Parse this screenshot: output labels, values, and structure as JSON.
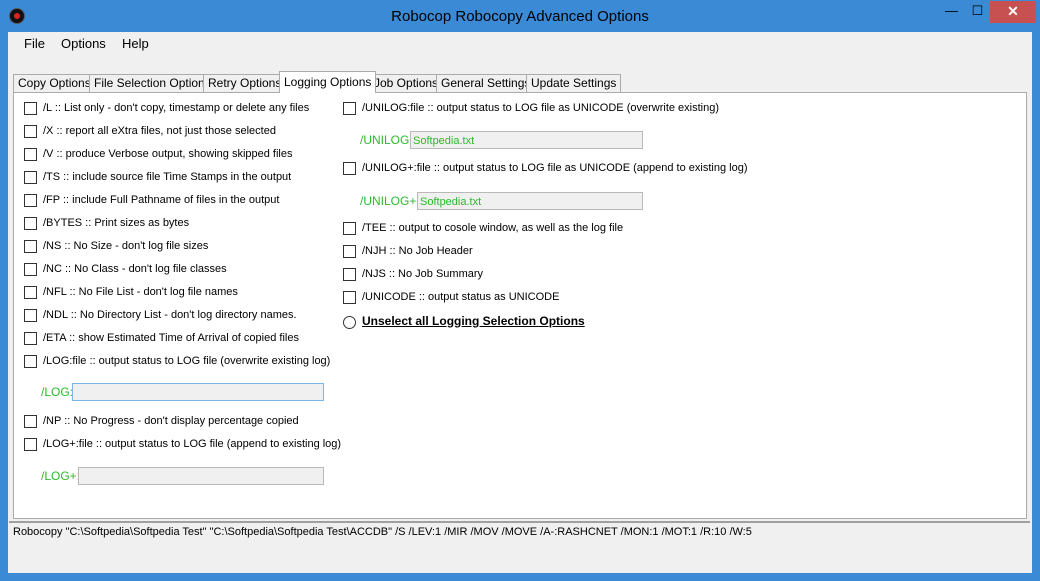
{
  "window": {
    "title": "Robocop Robocopy Advanced Options",
    "minimize": "—",
    "maximize": "☐",
    "close": "✕"
  },
  "menu": [
    "File",
    "Options",
    "Help"
  ],
  "tabs": [
    {
      "label": "Copy Options"
    },
    {
      "label": "File Selection Options"
    },
    {
      "label": "Retry Options"
    },
    {
      "label": "Logging Options"
    },
    {
      "label": "Job Options"
    },
    {
      "label": "General Settings"
    },
    {
      "label": "Update Settings"
    }
  ],
  "active_tab": "Logging Options",
  "left_options": [
    "/L :: List only - don't copy, timestamp or delete any files",
    "/X :: report all eXtra files, not just those selected",
    "/V :: produce Verbose output, showing skipped files",
    "/TS :: include source file Time Stamps in the output",
    "/FP :: include Full Pathname of files in the output",
    "/BYTES :: Print sizes as bytes",
    "/NS :: No Size - don't log file sizes",
    "/NC :: No Class - don't log file classes",
    "/NFL :: No File List - don't log file names",
    "/NDL :: No Directory List - don't log directory names.",
    "/ETA :: show Estimated Time of Arrival of copied files",
    "/LOG:file :: output status to LOG file (overwrite existing log)",
    "/NP :: No Progress - don't display percentage copied",
    "/LOG+:file :: output status to LOG file (append to existing log)"
  ],
  "log_field": {
    "label": "/LOG:",
    "value": ""
  },
  "logplus_field": {
    "label": "/LOG+:",
    "value": ""
  },
  "right_options": [
    "/UNILOG:file :: output status to LOG file as UNICODE (overwrite existing)",
    "/UNILOG+:file :: output status to LOG file as UNICODE (append to existing log)",
    "/TEE :: output to cosole window, as well as the log file",
    "/NJH :: No Job Header",
    "/NJS :: No Job Summary",
    "/UNICODE :: output status as UNICODE"
  ],
  "unilog_field": {
    "label": "/UNILOG:",
    "value": "Softpedia.txt"
  },
  "unilogplus_field": {
    "label": "/UNILOG+:",
    "value": "Softpedia.txt"
  },
  "unselect_label": "Unselect all Logging Selection Options",
  "command": "Robocopy \"C:\\Softpedia\\Softpedia Test\" \"C:\\Softpedia\\Softpedia Test\\ACCDB\" /S /LEV:1 /MIR /MOV /MOVE /A-:RASHCNET /MON:1 /MOT:1 /R:10 /W:5",
  "colors": {
    "titlebar": "#3a8ad6",
    "field_text": "#2db82d",
    "close_button": "#c75050"
  }
}
